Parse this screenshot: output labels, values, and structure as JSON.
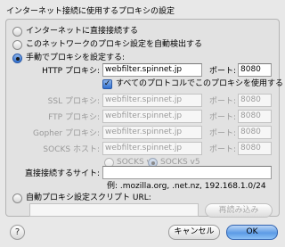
{
  "title": "インターネット接続に使用するプロキシの設定",
  "options": {
    "no_proxy": "インターネットに直接接続する",
    "auto_detect": "このネットワークのプロキシ設定を自動検出する",
    "manual": "手動でプロキシを設定する:",
    "auto_config": "自動プロキシ設定スクリプト URL:"
  },
  "proxies": {
    "http": {
      "label": "HTTP プロキシ:",
      "host": "webfilter.spinnet.jp",
      "port_label": "ポート:",
      "port": "8080"
    },
    "share_all": "すべてのプロトコルでこのプロキシを使用する",
    "ssl": {
      "label": "SSL プロキシ:",
      "host": "webfilter.spinnet.jp",
      "port_label": "ポート:",
      "port": "8080"
    },
    "ftp": {
      "label": "FTP プロキシ:",
      "host": "webfilter.spinnet.jp",
      "port_label": "ポート:",
      "port": "8080"
    },
    "gopher": {
      "label": "Gopher プロキシ:",
      "host": "webfilter.spinnet.jp",
      "port_label": "ポート:",
      "port": "8080"
    },
    "socks": {
      "label": "SOCKS ホスト:",
      "host": "webfilter.spinnet.jp",
      "port_label": "ポート:",
      "port": "8080"
    },
    "socks_v4": "SOCKS v4",
    "socks_v5": "SOCKS v5"
  },
  "no_proxy_for": {
    "label": "直接接続するサイト:",
    "value": "",
    "example": "例: .mozilla.org, .net.nz, 192.168.1.0/24"
  },
  "auto_config_url": "",
  "buttons": {
    "reload": "再読み込み",
    "help": "?",
    "cancel": "キャンセル",
    "ok": "OK"
  }
}
